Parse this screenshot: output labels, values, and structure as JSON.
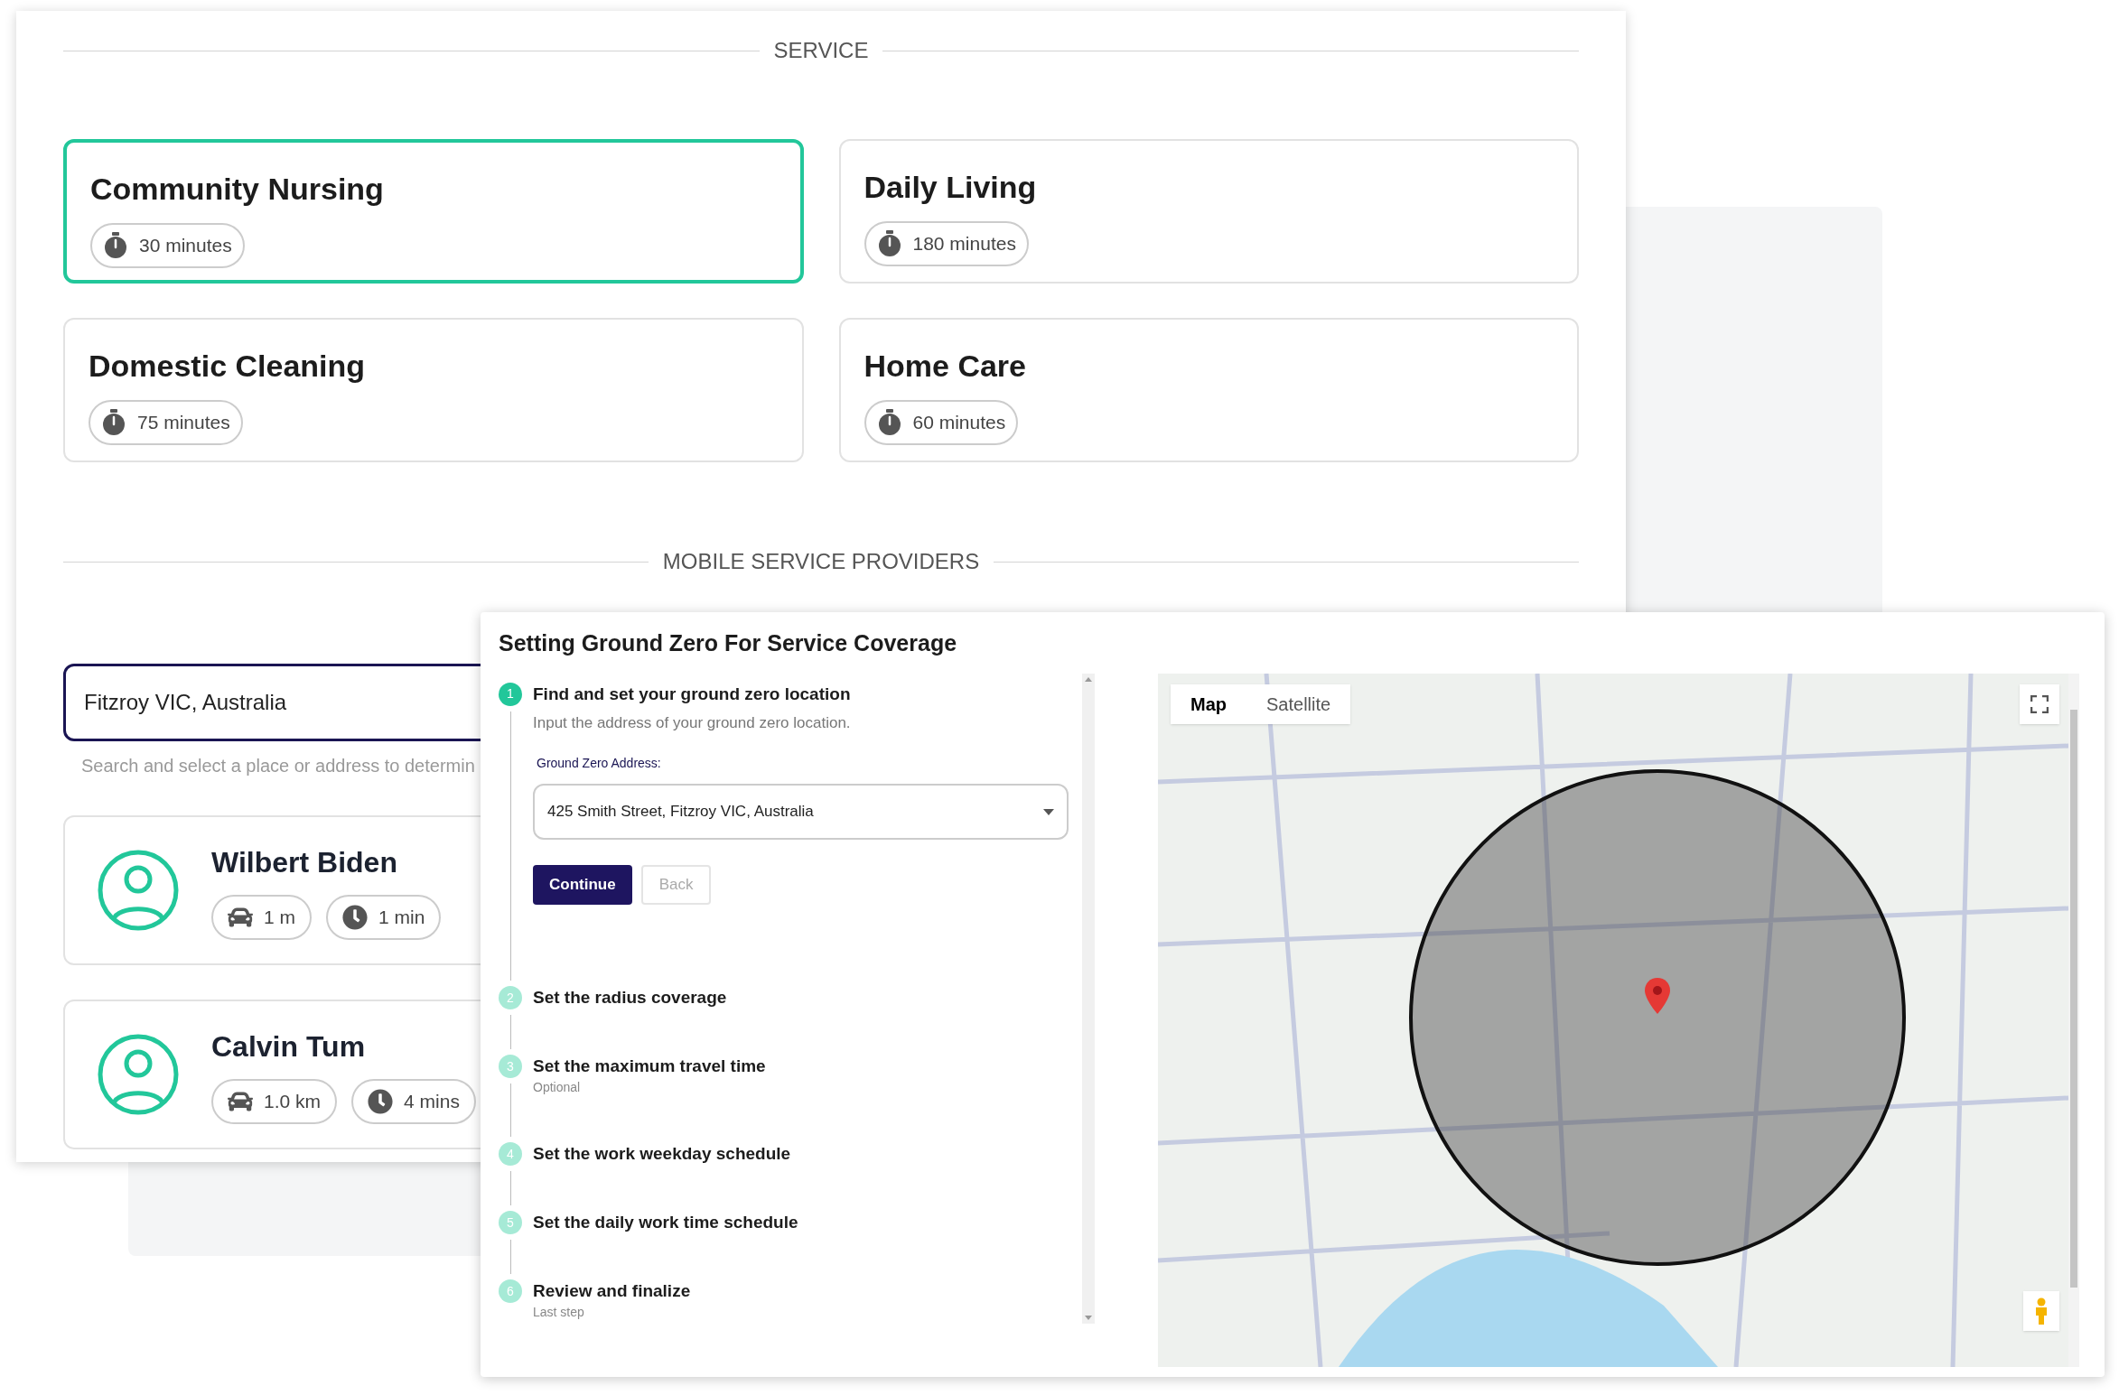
{
  "service_section": {
    "heading": "SERVICE",
    "services": [
      {
        "name": "Community Nursing",
        "duration": "30 minutes",
        "selected": true
      },
      {
        "name": "Daily Living",
        "duration": "180 minutes",
        "selected": false
      },
      {
        "name": "Domestic Cleaning",
        "duration": "75 minutes",
        "selected": false
      },
      {
        "name": "Home Care",
        "duration": "60 minutes",
        "selected": false
      }
    ]
  },
  "providers_section": {
    "heading": "MOBILE SERVICE PROVIDERS",
    "search": {
      "value": "Fitzroy VIC, Australia",
      "helper": "Search and select a place or address to determin"
    },
    "providers": [
      {
        "name": "Wilbert Biden",
        "distance": "1 m",
        "time": "1 min"
      },
      {
        "name": "Calvin Tum",
        "distance": "1.0 km",
        "time": "4 mins"
      }
    ]
  },
  "dialog": {
    "title": "Setting Ground Zero For Service Coverage",
    "steps": [
      {
        "number": "1",
        "title": "Find and set your ground zero location",
        "subtitle": "Input the address of your ground zero location.",
        "active": true,
        "expanded": true
      },
      {
        "number": "2",
        "title": "Set the radius coverage",
        "active": false,
        "expanded": false
      },
      {
        "number": "3",
        "title": "Set the maximum travel time",
        "subtitle": "Optional",
        "active": false,
        "expanded": false
      },
      {
        "number": "4",
        "title": "Set the work weekday schedule",
        "active": false,
        "expanded": false
      },
      {
        "number": "5",
        "title": "Set the daily work time schedule",
        "active": false,
        "expanded": false
      },
      {
        "number": "6",
        "title": "Review and finalize",
        "subtitle": "Last step",
        "active": false,
        "expanded": false
      }
    ],
    "address_label": "Ground Zero Address:",
    "address_value": "425 Smith Street, Fitzroy VIC, Australia",
    "buttons": [
      {
        "label": "Continue",
        "disabled": false
      },
      {
        "label": "Back",
        "disabled": true
      }
    ],
    "map": {
      "tabs": [
        {
          "label": "Map",
          "selected": true
        },
        {
          "label": "Satellite",
          "selected": false
        }
      ]
    }
  }
}
